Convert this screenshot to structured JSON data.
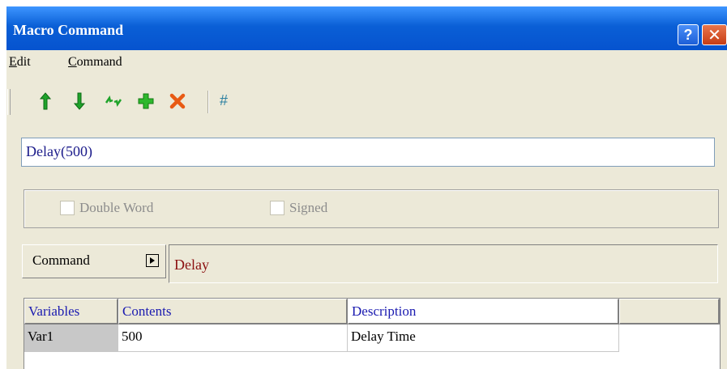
{
  "window": {
    "title": "Macro Command",
    "help_label": "?",
    "close_label": "✕"
  },
  "menu": {
    "items": [
      "Edit",
      "Command"
    ]
  },
  "toolbar": {
    "icons": [
      "move-up-icon",
      "move-down-icon",
      "swap-icon",
      "add-icon",
      "delete-icon"
    ],
    "hash_label": "#"
  },
  "expression": {
    "value": "Delay(500)"
  },
  "options": {
    "double_word": "Double Word",
    "signed": "Signed"
  },
  "command": {
    "button_label": "Command",
    "current": "Delay"
  },
  "grid": {
    "headers": [
      "Variables",
      "Contents",
      "Description"
    ],
    "rows": [
      {
        "variable": "Var1",
        "contents": "500",
        "description": "Delay Time"
      }
    ]
  },
  "colors": {
    "title_bar": "#0a5fd6",
    "header_text": "#1a1ab0",
    "command_text": "#8b1010"
  }
}
